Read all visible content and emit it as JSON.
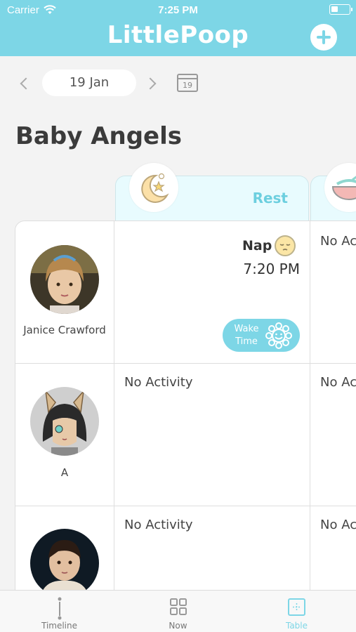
{
  "status_bar": {
    "carrier": "Carrier",
    "time": "7:25 PM"
  },
  "header": {
    "title": "LittlePoop",
    "add_icon": "plus-icon"
  },
  "date_nav": {
    "date": "19 Jan",
    "calendar_day": "19"
  },
  "section": {
    "title": "Baby Angels"
  },
  "columns": [
    {
      "label": "Rest",
      "icon": "moon-star-icon"
    },
    {
      "label": "",
      "icon": "bowl-icon"
    }
  ],
  "rows": [
    {
      "name": "Janice Crawford",
      "rest": {
        "activity": "Nap",
        "time": "7:20 PM",
        "button_line1": "Wake",
        "button_line2": "Time"
      },
      "feed": "No Ac"
    },
    {
      "name": "A",
      "rest": {
        "activity": "No Activity"
      },
      "feed": "No Ac"
    },
    {
      "name": "",
      "rest": {
        "activity": "No Activity"
      },
      "feed": "No Ac"
    }
  ],
  "tabs": [
    {
      "label": "Timeline",
      "icon": "timeline-icon"
    },
    {
      "label": "Now",
      "icon": "grid-icon"
    },
    {
      "label": "Table",
      "icon": "table-icon",
      "active": true
    }
  ],
  "colors": {
    "accent": "#7dd6e6",
    "header_light": "#e8fbfe",
    "background": "#f3f3f3"
  }
}
